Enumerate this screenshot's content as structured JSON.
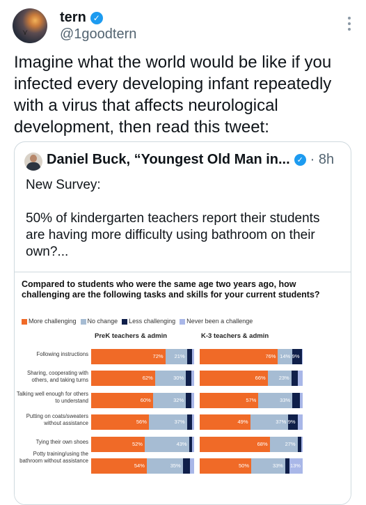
{
  "tweet": {
    "name": "tern",
    "handle": "@1goodtern",
    "text": "Imagine what the world would be like if you infected every developing infant repeatedly with a virus that affects neurological development, then read this tweet:"
  },
  "quoted": {
    "name": "Daniel Buck, “Youngest Old Man in...",
    "time": "· 8h",
    "lines": [
      "New Survey:",
      "50% of kindergarten teachers report their students are having more difficulty using bathroom on their own?..."
    ]
  },
  "colors": {
    "more": "#f06a27",
    "nochange": "#a6bcd3",
    "less": "#0f1f4a",
    "never": "#a9b7e8"
  },
  "chart_data": {
    "type": "bar",
    "title": "Compared to students who were the same age two years ago, how challenging are the following tasks and skills for your current students?",
    "legend": [
      "More challenging",
      "No change",
      "Less challenging",
      "Never been a challenge"
    ],
    "categories": [
      "Following instructions",
      "Sharing, cooperating with others, and taking turns",
      "Talking well enough for others to understand",
      "Putting on coats/sweaters without assistance",
      "Tying their own shoes",
      "Potty training/using the bathroom without assistance"
    ],
    "groups": [
      {
        "name": "PreK teachers & admin",
        "rows": [
          {
            "more": 72,
            "nochange": 21,
            "less": 5,
            "never": 2,
            "labels": [
              "72%",
              "21%",
              "",
              ""
            ]
          },
          {
            "more": 62,
            "nochange": 30,
            "less": 5,
            "never": 3,
            "labels": [
              "62%",
              "30%",
              "",
              ""
            ]
          },
          {
            "more": 60,
            "nochange": 32,
            "less": 5,
            "never": 3,
            "labels": [
              "60%",
              "32%",
              "",
              ""
            ]
          },
          {
            "more": 56,
            "nochange": 37,
            "less": 5,
            "never": 2,
            "labels": [
              "56%",
              "37%",
              "",
              ""
            ]
          },
          {
            "more": 52,
            "nochange": 43,
            "less": 3,
            "never": 2,
            "labels": [
              "52%",
              "43%",
              "",
              ""
            ]
          },
          {
            "more": 54,
            "nochange": 35,
            "less": 7,
            "never": 4,
            "labels": [
              "54%",
              "35%",
              "",
              ""
            ]
          }
        ]
      },
      {
        "name": "K-3 teachers & admin",
        "rows": [
          {
            "more": 76,
            "nochange": 14,
            "less": 9,
            "never": 1,
            "labels": [
              "76%",
              "14%",
              "9%",
              ""
            ]
          },
          {
            "more": 66,
            "nochange": 23,
            "less": 6,
            "never": 5,
            "labels": [
              "66%",
              "23%",
              "",
              ""
            ]
          },
          {
            "more": 57,
            "nochange": 33,
            "less": 7,
            "never": 3,
            "labels": [
              "57%",
              "33%",
              "",
              ""
            ]
          },
          {
            "more": 49,
            "nochange": 37,
            "less": 9,
            "never": 5,
            "labels": [
              "49%",
              "37%",
              "9%",
              ""
            ]
          },
          {
            "more": 68,
            "nochange": 27,
            "less": 4,
            "never": 1,
            "labels": [
              "68%",
              "27%",
              "",
              ""
            ]
          },
          {
            "more": 50,
            "nochange": 33,
            "less": 4,
            "never": 13,
            "labels": [
              "50%",
              "33%",
              "",
              "13%"
            ]
          }
        ]
      }
    ]
  }
}
